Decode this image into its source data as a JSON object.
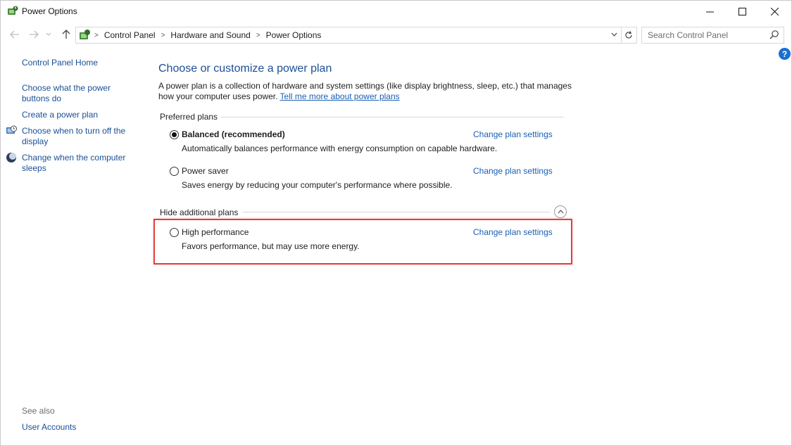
{
  "window": {
    "title": "Power Options"
  },
  "address": {
    "crumbs": [
      "Control Panel",
      "Hardware and Sound",
      "Power Options"
    ],
    "search_placeholder": "Search Control Panel"
  },
  "left_pane": {
    "home": "Control Panel Home",
    "links": [
      "Choose what the power buttons do",
      "Create a power plan",
      "Choose when to turn off the display",
      "Change when the computer sleeps"
    ],
    "see_also_label": "See also",
    "see_also_links": [
      "User Accounts"
    ]
  },
  "main": {
    "heading": "Choose or customize a power plan",
    "intro": "A power plan is a collection of hardware and system settings (like display brightness, sleep, etc.) that manages how your computer uses power.",
    "intro_link": "Tell me more about power plans",
    "preferred_label": "Preferred plans",
    "hide_label": "Hide additional plans",
    "change_link_label": "Change plan settings",
    "plans": [
      {
        "name": "Balanced (recommended)",
        "desc": "Automatically balances performance with energy consumption on capable hardware.",
        "selected": true
      },
      {
        "name": "Power saver",
        "desc": "Saves energy by reducing your computer's performance where possible.",
        "selected": false
      },
      {
        "name": "High performance",
        "desc": "Favors performance, but may use more energy.",
        "selected": false
      }
    ]
  },
  "colors": {
    "link": "#1a5fb4",
    "heading": "#1a4f96",
    "highlight": "#e04040"
  }
}
